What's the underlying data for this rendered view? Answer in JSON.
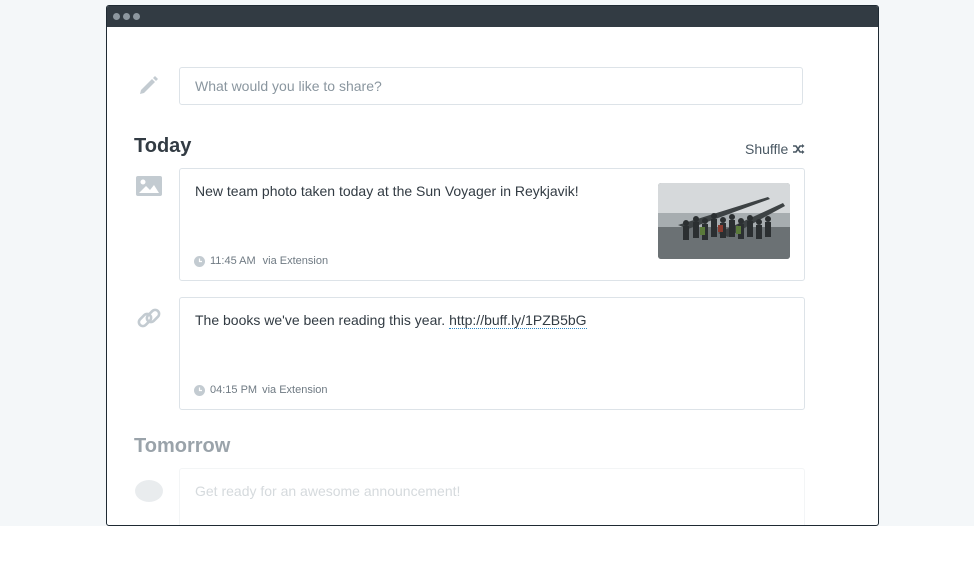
{
  "composer": {
    "placeholder": "What would you like to share?"
  },
  "sections": {
    "today": {
      "title": "Today",
      "shuffle_label": "Shuffle"
    },
    "tomorrow": {
      "title": "Tomorrow"
    }
  },
  "posts": [
    {
      "text": "New team photo taken today at the Sun Voyager in Reykjavik!",
      "time": "11:45 AM",
      "via": "via Extension",
      "icon": "image-icon"
    },
    {
      "text": "The books we've been reading this year.",
      "link": "http://buff.ly/1PZB5bG",
      "time": "04:15 PM",
      "via": "via Extension",
      "icon": "link-icon"
    },
    {
      "text": "Get ready for an awesome announcement!"
    }
  ],
  "colors": {
    "titlebar": "#323b43",
    "link_underline": "#2c87c5",
    "border": "#dde3e8"
  }
}
